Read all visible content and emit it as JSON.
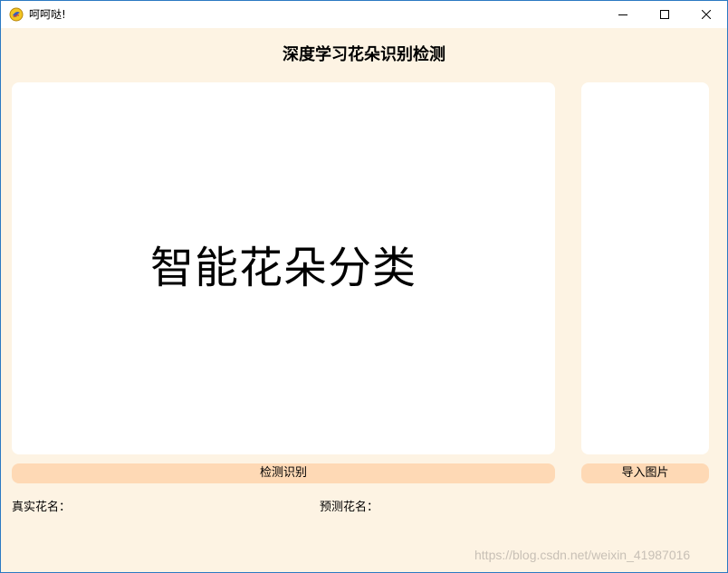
{
  "window": {
    "title": "呵呵哒!",
    "icon": "python-feather-icon",
    "controls": {
      "minimize": "minimize-icon",
      "maximize": "maximize-icon",
      "close": "close-icon"
    }
  },
  "app": {
    "heading": "深度学习花朵识别检测",
    "display_text": "智能花朵分类",
    "detect_button": "检测识别",
    "import_button": "导入图片",
    "true_label": "真实花名：",
    "pred_label": "预测花名："
  },
  "watermark": "https://blog.csdn.net/weixin_41987016",
  "colors": {
    "background": "#fdf3e3",
    "button": "#fed9b5",
    "panel": "#ffffff"
  }
}
